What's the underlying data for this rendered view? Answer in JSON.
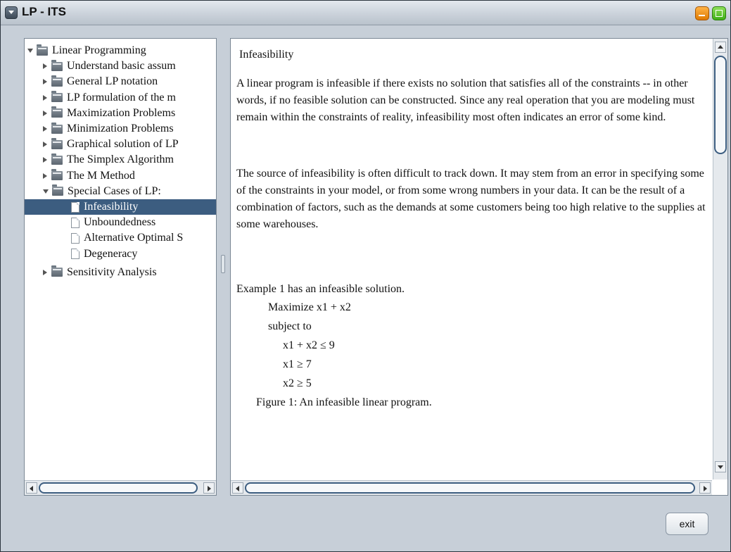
{
  "window": {
    "title": "LP - ITS"
  },
  "tree": [
    {
      "label": "Linear Programming",
      "type": "folder",
      "state": "expanded",
      "level": 0
    },
    {
      "label": "Understand basic assum",
      "type": "folder",
      "state": "collapsed",
      "level": 1
    },
    {
      "label": "General LP notation",
      "type": "folder",
      "state": "collapsed",
      "level": 1
    },
    {
      "label": "LP formulation of the m",
      "type": "folder",
      "state": "collapsed",
      "level": 1
    },
    {
      "label": "Maximization Problems",
      "type": "folder",
      "state": "collapsed",
      "level": 1
    },
    {
      "label": "Minimization Problems",
      "type": "folder",
      "state": "collapsed",
      "level": 1
    },
    {
      "label": "Graphical solution of LP",
      "type": "folder",
      "state": "collapsed",
      "level": 1
    },
    {
      "label": "The Simplex Algorithm",
      "type": "folder",
      "state": "collapsed",
      "level": 1
    },
    {
      "label": "The M Method",
      "type": "folder",
      "state": "collapsed",
      "level": 1
    },
    {
      "label": "Special Cases of LP:",
      "type": "folder",
      "state": "expanded",
      "level": 1
    },
    {
      "label": "Infeasibility",
      "type": "doc",
      "state": "selected",
      "level": 2
    },
    {
      "label": "Unboundedness",
      "type": "doc",
      "state": "",
      "level": 2
    },
    {
      "label": "Alternative Optimal S",
      "type": "doc",
      "state": "",
      "level": 2
    },
    {
      "label": "Degeneracy",
      "type": "doc",
      "state": "",
      "level": 2
    },
    {
      "label": "Sensitivity Analysis",
      "type": "folder",
      "state": "collapsed",
      "level": 1
    }
  ],
  "content": {
    "heading": "Infeasibility",
    "paragraph1": "A linear program is infeasible if there exists no solution that satisfies all of the constraints -- in other words, if no feasible solution can be constructed. Since any real operation that you are modeling must remain within the constraints of reality, infeasibility most often indicates an error of some kind.",
    "paragraph2": "The source of infeasibility is often difficult to track down. It may stem from an error in specifying some of the constraints in your model, or from some wrong numbers in your data. It can be the result of a combination of factors, such as the demands at some customers being too high relative to the supplies at some warehouses.",
    "example_intro": "Example 1 has an infeasible solution.",
    "objective": "Maximize x1 + x2",
    "subject_to": "subject to",
    "constraints": [
      "x1 + x2 ≤ 9",
      "x1 ≥ 7",
      "x2 ≥ 5"
    ],
    "caption": "Figure 1: An infeasible linear program."
  },
  "buttons": {
    "exit": "exit"
  },
  "colors": {
    "selection": "#3c5d80",
    "window_background": "#c7cfd8",
    "title_bar": "#cfd6de"
  }
}
